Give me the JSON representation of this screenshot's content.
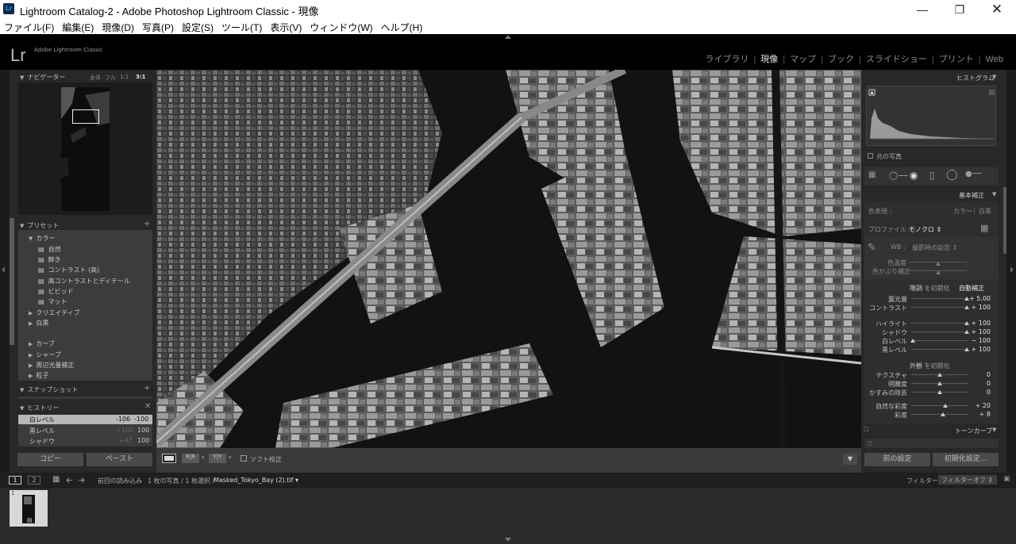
{
  "window": {
    "title": "Lightroom Catalog-2 - Adobe Photoshop Lightroom Classic - 現像",
    "app_icon": "Lr"
  },
  "menu": [
    "ファイル(F)",
    "編集(E)",
    "現像(D)",
    "写真(P)",
    "設定(S)",
    "ツール(T)",
    "表示(V)",
    "ウィンドウ(W)",
    "ヘルプ(H)"
  ],
  "brand": {
    "logo": "Lr",
    "name": "Adobe Lightroom Classic"
  },
  "modules": [
    "ライブラリ",
    "現像",
    "マップ",
    "ブック",
    "スライドショー",
    "プリント",
    "Web"
  ],
  "active_module": "現像",
  "navigator": {
    "title": "ナビゲーター",
    "zoom": [
      "全体",
      "フル",
      "1:1",
      "3:1"
    ],
    "active_zoom": "3:1"
  },
  "presets": {
    "title": "プリセット",
    "groups": [
      {
        "name": "カラー",
        "expanded": true,
        "items": [
          "自然",
          "鮮き",
          "コントラスト (高)",
          "高コントラストとディテール",
          "ビビッド",
          "マット"
        ]
      },
      {
        "name": "クリエイティブ",
        "expanded": false
      },
      {
        "name": "白黒",
        "expanded": false
      },
      {
        "name": "カーブ",
        "expanded": false
      },
      {
        "name": "シャープ",
        "expanded": false
      },
      {
        "name": "周辺光量補正",
        "expanded": false
      },
      {
        "name": "粒子",
        "expanded": false
      }
    ]
  },
  "snapshot": {
    "title": "スナップショット"
  },
  "history": {
    "title": "ヒストリー",
    "rows": [
      {
        "name": "白レベル",
        "a": "-106",
        "b": "-100",
        "selected": true
      },
      {
        "name": "黒レベル",
        "a": "+100",
        "b": "100",
        "selected": false
      },
      {
        "name": "シャドウ",
        "a": "+47",
        "b": "100",
        "selected": false
      }
    ]
  },
  "left_buttons": {
    "copy": "コピー",
    "paste": "ペースト"
  },
  "toolbar": {
    "softproof": "ソフト校正",
    "view_xy": "Y|Y"
  },
  "histogram": {
    "title": "ヒストグラム",
    "original_photo": "元の写真"
  },
  "basic": {
    "title": "基本補正",
    "treatment_label": "色表現 :",
    "color": "カラー",
    "bw": "白黒",
    "profile_label": "プロファイル :",
    "profile_value": "モノクロ",
    "wb_label": "WB :",
    "wb_value": "撮影時の設定",
    "temp": "色温度",
    "tint": "色かぶり補正",
    "tone_label": "階調",
    "tone_reset": "を初期化",
    "auto": "自動補正",
    "sliders": [
      {
        "name": "露光量",
        "value": "+ 5.00",
        "pct": 0.97
      },
      {
        "name": "コントラスト",
        "value": "+ 100",
        "pct": 0.97
      },
      {
        "name": "ハイライト",
        "value": "+ 100",
        "pct": 0.97
      },
      {
        "name": "シャドウ",
        "value": "+ 100",
        "pct": 0.97
      },
      {
        "name": "白レベル",
        "value": "− 100",
        "pct": 0.03
      },
      {
        "name": "黒レベル",
        "value": "+ 100",
        "pct": 0.97
      }
    ],
    "presence_label": "外観",
    "presence_reset": "を初期化",
    "presence": [
      {
        "name": "テクスチャ",
        "value": "0",
        "pct": 0.5
      },
      {
        "name": "明瞭度",
        "value": "0",
        "pct": 0.5
      },
      {
        "name": "かすみの除去",
        "value": "0",
        "pct": 0.5
      },
      {
        "name": "自然な彩度",
        "value": "+ 20",
        "pct": 0.6
      },
      {
        "name": "彩度",
        "value": "+ 8",
        "pct": 0.55
      }
    ]
  },
  "tone_curve": {
    "title": "トーンカーブ"
  },
  "right_buttons": {
    "prev": "前の設定",
    "reset": "初期化設定..."
  },
  "filmstrip_bar": {
    "pages": [
      "1",
      "2"
    ],
    "source": "前回の読み込み",
    "count": "1 枚の写真 / 1 枚選択 /",
    "filename": "Masked_Tokyo_Bay (2).tif",
    "filter_label": "フィルター :",
    "filter_value": "フィルターオフ"
  },
  "thumb_index": "1"
}
